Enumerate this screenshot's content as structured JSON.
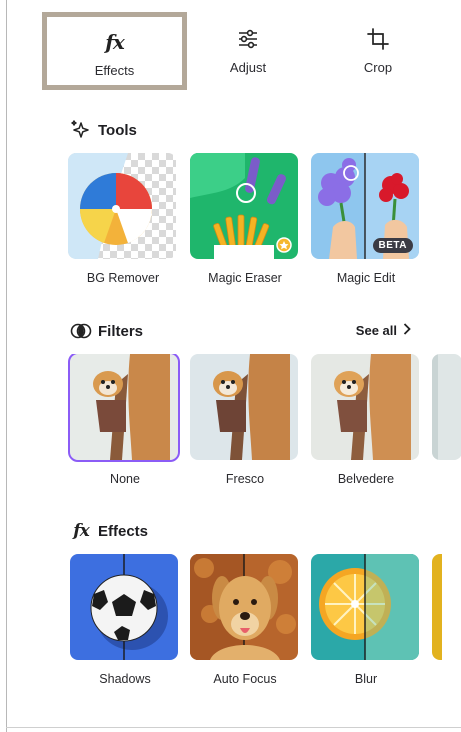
{
  "tabs": [
    {
      "label": "Effects",
      "icon": "fx-icon",
      "selected": true
    },
    {
      "label": "Adjust",
      "icon": "sliders-icon",
      "selected": false
    },
    {
      "label": "Crop",
      "icon": "crop-icon",
      "selected": false
    }
  ],
  "tools": {
    "title": "Tools",
    "icon": "sparkle-icon",
    "items": [
      {
        "label": "BG Remover"
      },
      {
        "label": "Magic Eraser"
      },
      {
        "label": "Magic Edit",
        "badge": "BETA"
      }
    ]
  },
  "filters": {
    "title": "Filters",
    "icon": "filters-icon",
    "see_all": "See all",
    "items": [
      {
        "label": "None",
        "selected": true
      },
      {
        "label": "Fresco"
      },
      {
        "label": "Belvedere"
      }
    ]
  },
  "effects": {
    "title": "Effects",
    "icon": "fx-icon",
    "items": [
      {
        "label": "Shadows"
      },
      {
        "label": "Auto Focus"
      },
      {
        "label": "Blur"
      }
    ]
  },
  "colors": {
    "selected_tab_border": "#b3a899",
    "selected_card_outline": "#8b5cf6"
  }
}
